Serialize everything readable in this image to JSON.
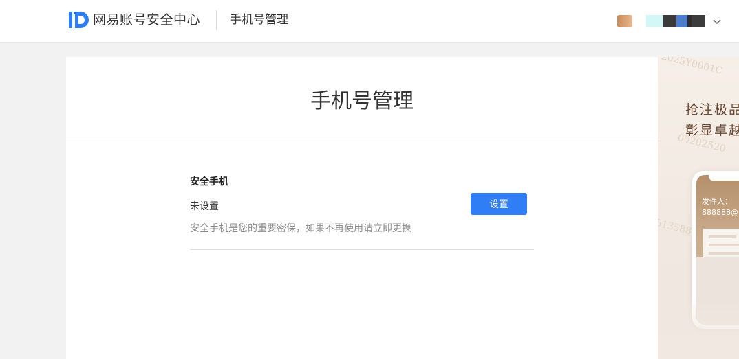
{
  "header": {
    "brand": "网易账号安全中心",
    "page_name": "手机号管理",
    "account_masked": ""
  },
  "main": {
    "title": "手机号管理",
    "section_title": "安全手机",
    "status": "未设置",
    "set_button_label": "设置",
    "hint": "安全手机是您的重要密保，如果不再使用请立即更换"
  },
  "promo": {
    "slogan_line1": "抢注极品",
    "slogan_line2": "彰显卓越",
    "sender_label": "发件人：",
    "sender_email": "888888@"
  },
  "colors": {
    "brand_blue": "#2f7ef5",
    "header_bg": "#ffffff",
    "page_bg": "#f2f2f2"
  },
  "icons": {
    "logo": "id-logo-icon",
    "dropdown": "chevron-down-icon"
  }
}
